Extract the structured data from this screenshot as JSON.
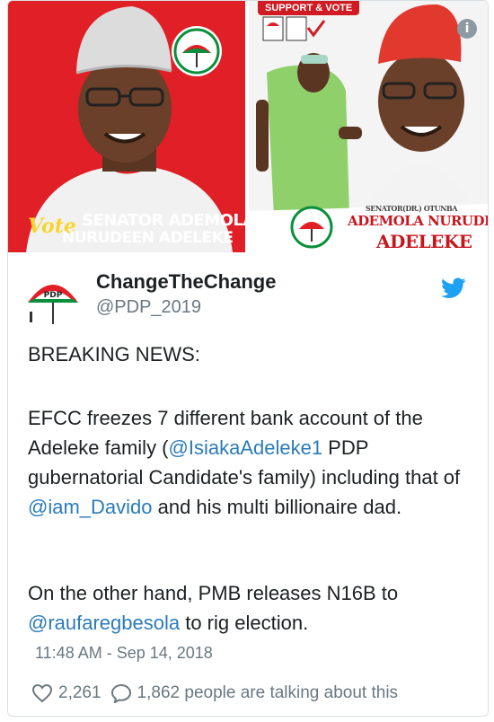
{
  "media": {
    "left_poster": {
      "vote_word": "Vote",
      "name_line1": "SENATOR ADEMOLA",
      "name_line2": "NURUDEEN ADELEKE"
    },
    "right_poster": {
      "support_text": "SUPPORT & VOTE",
      "senator_text": "SENATOR(DR.) OTUNBA",
      "name_line1": "ADEMOLA NURUDEEN",
      "name_line2": "ADELEKE"
    },
    "info_icon": "i"
  },
  "tweet": {
    "display_name": "ChangeTheChange",
    "handle": "@PDP_2019",
    "avatar_text": "PDP",
    "paragraph1": "BREAKING NEWS:",
    "paragraph2_parts": {
      "a": "EFCC freezes 7 different bank account of the Adeleke family (",
      "mention1": "@IsiakaAdeleke1",
      "b": " PDP gubernatorial Candidate's family) including that of ",
      "mention2": "@iam_Davido",
      "c": " and his multi billionaire dad."
    },
    "paragraph3_parts": {
      "a": "On the other hand, PMB releases N16B to ",
      "mention": "@raufaregbesola",
      "b": " to rig election."
    },
    "timestamp": "11:48 AM - Sep 14, 2018",
    "likes": "2,261",
    "talking": "1,862 people are talking about this"
  },
  "colors": {
    "mention": "#2b7bb9",
    "twitter_blue": "#1da1f2",
    "poster_red": "#e11f26"
  }
}
